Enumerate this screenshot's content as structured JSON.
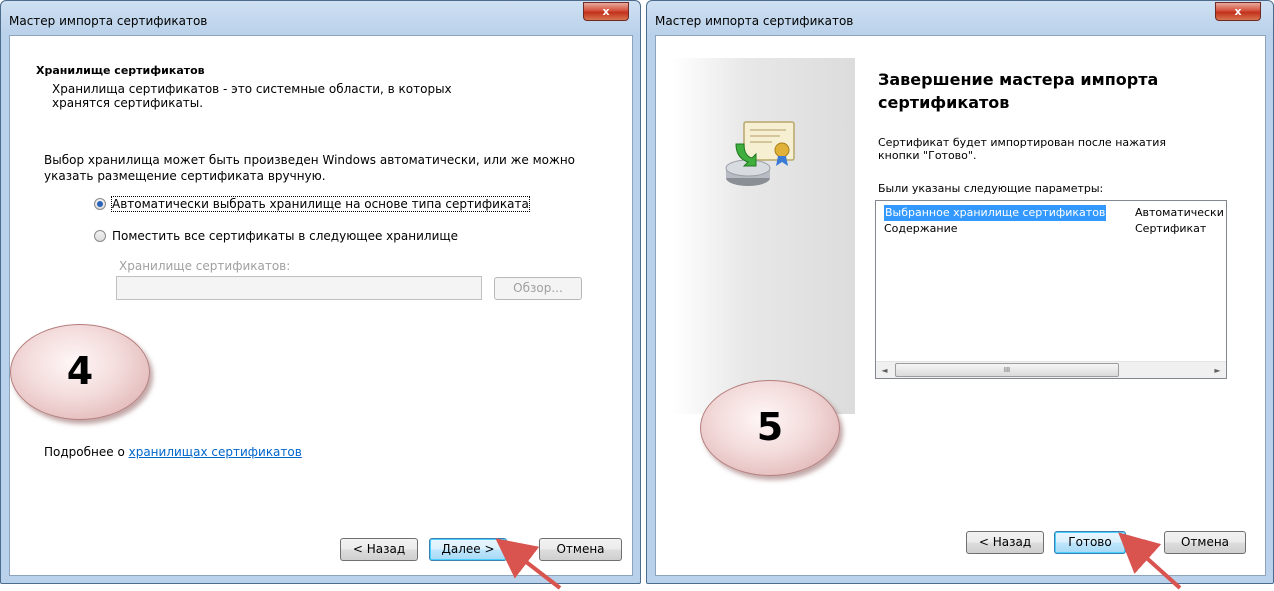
{
  "window1": {
    "title": "Мастер импорта сертификатов",
    "close_label": "x",
    "header_title": "Хранилище сертификатов",
    "header_description": "Хранилища сертификатов - это системные области, в которых хранятся сертификаты.",
    "intro_text": "Выбор хранилища может быть произведен Windows автоматически, или же можно указать размещение сертификата вручную.",
    "radio_auto": {
      "label": "Автоматически выбрать хранилище на основе типа сертификата",
      "selected": true
    },
    "radio_manual": {
      "label": "Поместить все сертификаты в следующее хранилище",
      "selected": false
    },
    "store_label": "Хранилище сертификатов:",
    "store_value": "",
    "browse_label": "Обзор...",
    "more_prefix": "Подробнее о ",
    "more_link": "хранилищах сертификатов",
    "back_label": "< Назад",
    "next_label": "Далее >",
    "cancel_label": "Отмена"
  },
  "window2": {
    "title": "Мастер импорта сертификатов",
    "close_label": "x",
    "heading": "Завершение мастера импорта сертификатов",
    "description": "Сертификат будет импортирован после нажатия кнопки \"Готово\".",
    "params_label": "Были указаны следующие параметры:",
    "params": [
      {
        "name": "Выбранное хранилище сертификатов",
        "value": "Автоматически"
      },
      {
        "name": "Содержание",
        "value": "Сертификат"
      }
    ],
    "scroll_thumb": "III",
    "back_label": "< Назад",
    "finish_label": "Готово",
    "cancel_label": "Отмена"
  },
  "step_badges": [
    "4",
    "5"
  ],
  "icons": {
    "wizard": "certificate-install-icon",
    "pointer": "red-arrow-pointer"
  },
  "colors": {
    "accent_arrow": "#d9534f",
    "selection": "#3399ff",
    "link": "#0066cc"
  }
}
